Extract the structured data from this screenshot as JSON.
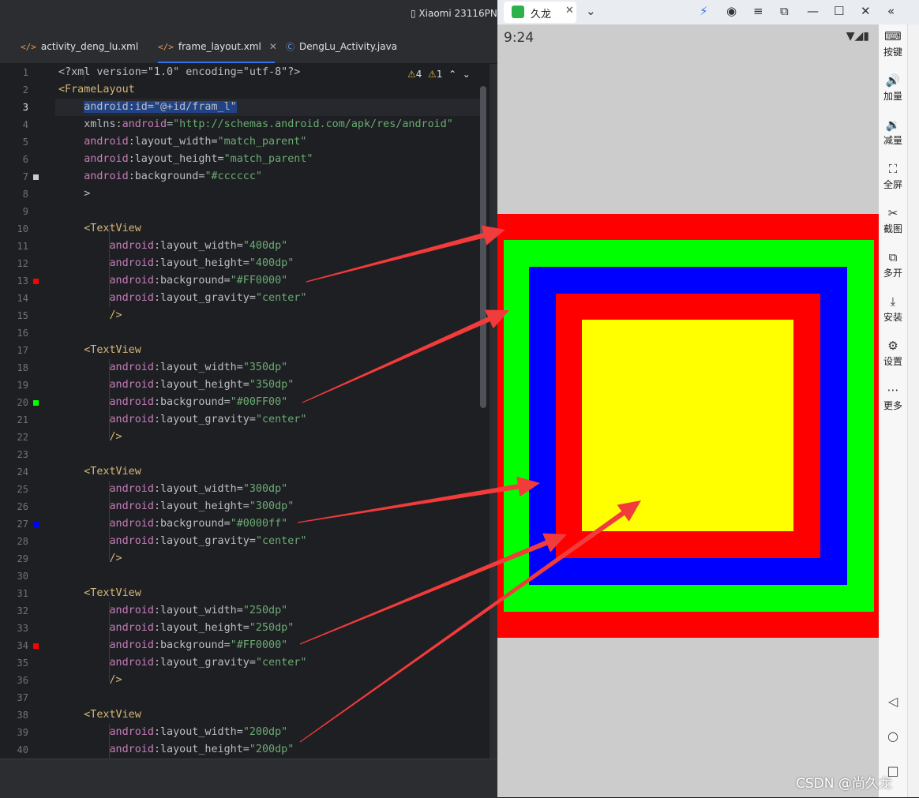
{
  "ide": {
    "device_label": "Xiaomi 23116PN",
    "tabs": [
      {
        "label": "activity_deng_lu.xml",
        "icon": "xml-file-icon"
      },
      {
        "label": "frame_layout.xml",
        "icon": "xml-file-icon",
        "active": true
      },
      {
        "label": "DengLu_Activity.java",
        "icon": "java-class-icon"
      }
    ],
    "inspections": {
      "warnings": "4",
      "weak_warnings": "1"
    },
    "current_line": 3,
    "lines": [
      {
        "n": "1",
        "t": [
          [
            "pl",
            "<?xml version=\"1.0\" encoding=\"utf-8\"?>"
          ]
        ]
      },
      {
        "n": "2",
        "t": [
          [
            "tg",
            "<FrameLayout"
          ]
        ]
      },
      {
        "n": "3",
        "t": [
          [
            "pl",
            "    "
          ],
          [
            "sel",
            "android:id=\"@+id/fram_l\""
          ]
        ]
      },
      {
        "n": "4",
        "t": [
          [
            "pl",
            "    xmlns:"
          ],
          [
            "ns",
            "android"
          ],
          [
            "pl",
            "="
          ],
          [
            "st",
            "\"http://schemas.android.com/apk/res/android\""
          ]
        ]
      },
      {
        "n": "5",
        "t": [
          [
            "pl",
            "    "
          ],
          [
            "at",
            "android"
          ],
          [
            "pl",
            ":layout_width="
          ],
          [
            "st",
            "\"match_parent\""
          ]
        ]
      },
      {
        "n": "6",
        "t": [
          [
            "pl",
            "    "
          ],
          [
            "at",
            "android"
          ],
          [
            "pl",
            ":layout_height="
          ],
          [
            "st",
            "\"match_parent\""
          ]
        ]
      },
      {
        "n": "7",
        "t": [
          [
            "pl",
            "    "
          ],
          [
            "at",
            "android"
          ],
          [
            "pl",
            ":background="
          ],
          [
            "st",
            "\"#cccccc\""
          ]
        ],
        "swatch": "#cccccc"
      },
      {
        "n": "8",
        "t": [
          [
            "pl",
            "    >"
          ]
        ]
      },
      {
        "n": "9",
        "t": []
      },
      {
        "n": "10",
        "t": [
          [
            "pl",
            "    "
          ],
          [
            "tg",
            "<TextView"
          ]
        ]
      },
      {
        "n": "11",
        "t": [
          [
            "pl",
            "        "
          ],
          [
            "at",
            "android"
          ],
          [
            "pl",
            ":layout_width="
          ],
          [
            "st",
            "\"400dp\""
          ]
        ]
      },
      {
        "n": "12",
        "t": [
          [
            "pl",
            "        "
          ],
          [
            "at",
            "android"
          ],
          [
            "pl",
            ":layout_height="
          ],
          [
            "st",
            "\"400dp\""
          ]
        ]
      },
      {
        "n": "13",
        "t": [
          [
            "pl",
            "        "
          ],
          [
            "at",
            "android"
          ],
          [
            "pl",
            ":background="
          ],
          [
            "st",
            "\"#FF0000\""
          ]
        ],
        "swatch": "#ff0000"
      },
      {
        "n": "14",
        "t": [
          [
            "pl",
            "        "
          ],
          [
            "at",
            "android"
          ],
          [
            "pl",
            ":layout_gravity="
          ],
          [
            "st",
            "\"center\""
          ]
        ]
      },
      {
        "n": "15",
        "t": [
          [
            "pl",
            "        "
          ],
          [
            "tg",
            "/>"
          ]
        ]
      },
      {
        "n": "16",
        "t": []
      },
      {
        "n": "17",
        "t": [
          [
            "pl",
            "    "
          ],
          [
            "tg",
            "<TextView"
          ]
        ]
      },
      {
        "n": "18",
        "t": [
          [
            "pl",
            "        "
          ],
          [
            "at",
            "android"
          ],
          [
            "pl",
            ":layout_width="
          ],
          [
            "st",
            "\"350dp\""
          ]
        ]
      },
      {
        "n": "19",
        "t": [
          [
            "pl",
            "        "
          ],
          [
            "at",
            "android"
          ],
          [
            "pl",
            ":layout_height="
          ],
          [
            "st",
            "\"350dp\""
          ]
        ]
      },
      {
        "n": "20",
        "t": [
          [
            "pl",
            "        "
          ],
          [
            "at",
            "android"
          ],
          [
            "pl",
            ":background="
          ],
          [
            "st",
            "\"#00FF00\""
          ]
        ],
        "swatch": "#00ff00"
      },
      {
        "n": "21",
        "t": [
          [
            "pl",
            "        "
          ],
          [
            "at",
            "android"
          ],
          [
            "pl",
            ":layout_gravity="
          ],
          [
            "st",
            "\"center\""
          ]
        ]
      },
      {
        "n": "22",
        "t": [
          [
            "pl",
            "        "
          ],
          [
            "tg",
            "/>"
          ]
        ]
      },
      {
        "n": "23",
        "t": []
      },
      {
        "n": "24",
        "t": [
          [
            "pl",
            "    "
          ],
          [
            "tg",
            "<TextView"
          ]
        ]
      },
      {
        "n": "25",
        "t": [
          [
            "pl",
            "        "
          ],
          [
            "at",
            "android"
          ],
          [
            "pl",
            ":layout_width="
          ],
          [
            "st",
            "\"300dp\""
          ]
        ]
      },
      {
        "n": "26",
        "t": [
          [
            "pl",
            "        "
          ],
          [
            "at",
            "android"
          ],
          [
            "pl",
            ":layout_height="
          ],
          [
            "st",
            "\"300dp\""
          ]
        ]
      },
      {
        "n": "27",
        "t": [
          [
            "pl",
            "        "
          ],
          [
            "at",
            "android"
          ],
          [
            "pl",
            ":background="
          ],
          [
            "st",
            "\"#0000ff\""
          ]
        ],
        "swatch": "#0000ff"
      },
      {
        "n": "28",
        "t": [
          [
            "pl",
            "        "
          ],
          [
            "at",
            "android"
          ],
          [
            "pl",
            ":layout_gravity="
          ],
          [
            "st",
            "\"center\""
          ]
        ]
      },
      {
        "n": "29",
        "t": [
          [
            "pl",
            "        "
          ],
          [
            "tg",
            "/>"
          ]
        ]
      },
      {
        "n": "30",
        "t": []
      },
      {
        "n": "31",
        "t": [
          [
            "pl",
            "    "
          ],
          [
            "tg",
            "<TextView"
          ]
        ]
      },
      {
        "n": "32",
        "t": [
          [
            "pl",
            "        "
          ],
          [
            "at",
            "android"
          ],
          [
            "pl",
            ":layout_width="
          ],
          [
            "st",
            "\"250dp\""
          ]
        ]
      },
      {
        "n": "33",
        "t": [
          [
            "pl",
            "        "
          ],
          [
            "at",
            "android"
          ],
          [
            "pl",
            ":layout_height="
          ],
          [
            "st",
            "\"250dp\""
          ]
        ]
      },
      {
        "n": "34",
        "t": [
          [
            "pl",
            "        "
          ],
          [
            "at",
            "android"
          ],
          [
            "pl",
            ":background="
          ],
          [
            "st",
            "\"#FF0000\""
          ]
        ],
        "swatch": "#ff0000"
      },
      {
        "n": "35",
        "t": [
          [
            "pl",
            "        "
          ],
          [
            "at",
            "android"
          ],
          [
            "pl",
            ":layout_gravity="
          ],
          [
            "st",
            "\"center\""
          ]
        ]
      },
      {
        "n": "36",
        "t": [
          [
            "pl",
            "        "
          ],
          [
            "tg",
            "/>"
          ]
        ]
      },
      {
        "n": "37",
        "t": []
      },
      {
        "n": "38",
        "t": [
          [
            "pl",
            "    "
          ],
          [
            "tg",
            "<TextView"
          ]
        ]
      },
      {
        "n": "39",
        "t": [
          [
            "pl",
            "        "
          ],
          [
            "at",
            "android"
          ],
          [
            "pl",
            ":layout_width="
          ],
          [
            "st",
            "\"200dp\""
          ]
        ]
      },
      {
        "n": "40",
        "t": [
          [
            "pl",
            "        "
          ],
          [
            "at",
            "android"
          ],
          [
            "pl",
            ":layout_height="
          ],
          [
            "st",
            "\"200dp\""
          ]
        ]
      }
    ]
  },
  "emulator": {
    "tab_title": "久龙",
    "status_time": "9:24",
    "screen_background": "#cccccc",
    "squares": [
      {
        "color": "#ff0000"
      },
      {
        "color": "#00ff00"
      },
      {
        "color": "#0000ff"
      },
      {
        "color": "#ff0000"
      },
      {
        "color": "#ffff00"
      }
    ],
    "toolbar": [
      {
        "label": "按键",
        "icon": "keyboard-icon"
      },
      {
        "label": "加量",
        "icon": "volume-up-icon"
      },
      {
        "label": "减量",
        "icon": "volume-down-icon"
      },
      {
        "label": "全屏",
        "icon": "fullscreen-icon"
      },
      {
        "label": "截图",
        "icon": "screenshot-icon"
      },
      {
        "label": "多开",
        "icon": "multi-instance-icon"
      },
      {
        "label": "安装",
        "icon": "install-apk-icon"
      },
      {
        "label": "设置",
        "icon": "settings-icon"
      },
      {
        "label": "更多",
        "icon": "more-icon"
      }
    ],
    "nav": [
      "back-icon",
      "home-icon",
      "recents-icon"
    ]
  },
  "annotation_color": "#f23b3b",
  "watermark": "CSDN @尚久龙"
}
